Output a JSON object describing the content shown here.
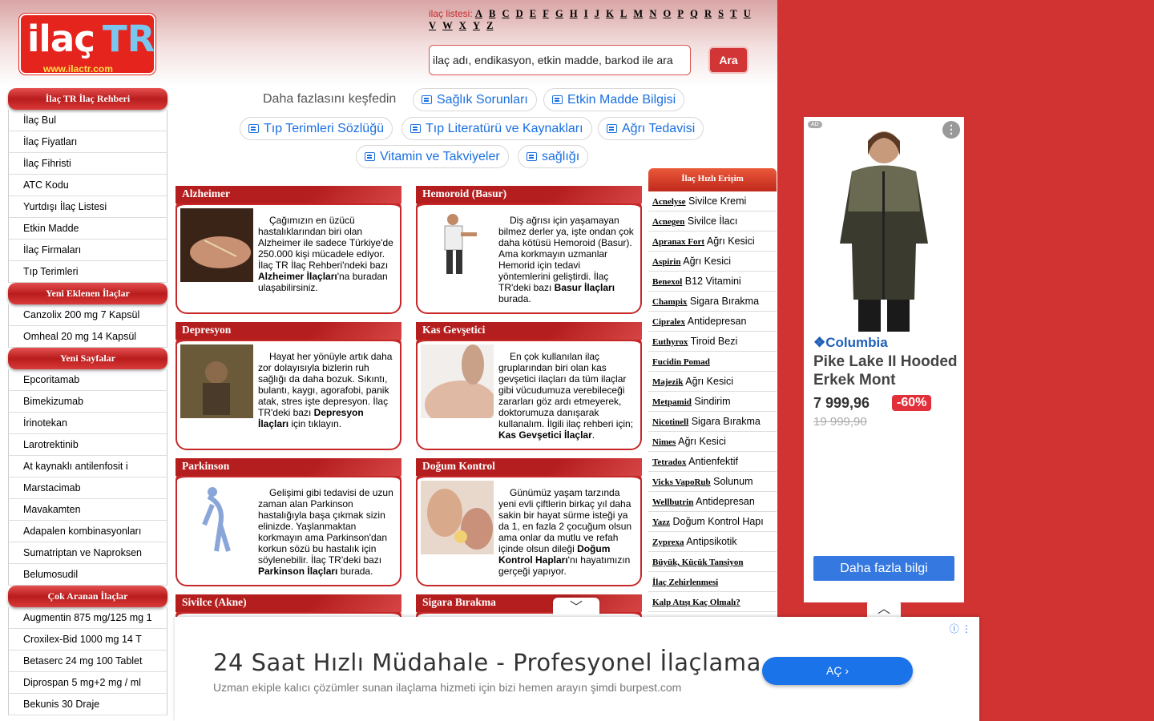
{
  "logo": {
    "part1": "ilaç",
    "part2": "TR",
    "url": "www.ilactr.com"
  },
  "alphabet": {
    "label": "ilaç listesi:",
    "letters": [
      "A",
      "B",
      "C",
      "D",
      "E",
      "F",
      "G",
      "H",
      "I",
      "J",
      "K",
      "L",
      "M",
      "N",
      "O",
      "P",
      "Q",
      "R",
      "S",
      "T",
      "U",
      "V",
      "W",
      "X",
      "Y",
      "Z"
    ]
  },
  "search": {
    "placeholder": "ilaç adı, endikasyon, etkin madde, barkod ile ara",
    "button": "Ara"
  },
  "sidebar": {
    "sections": [
      {
        "title": "İlaç TR İlaç Rehberi",
        "items": [
          "İlaç Bul",
          "İlaç Fiyatları",
          "İlaç Fihristi",
          "ATC Kodu",
          "Yurtdışı İlaç Listesi",
          "Etkin Madde",
          "İlaç Firmaları",
          "Tıp Terimleri"
        ]
      },
      {
        "title": "Yeni Eklenen İlaçlar",
        "items": [
          "Canzolix 200 mg 7 Kapsül",
          "Omheal 20 mg 14 Kapsül"
        ]
      },
      {
        "title": "Yeni Sayfalar",
        "items": [
          "Epcoritamab",
          "Bimekizumab",
          "İrinotekan",
          "Larotrektinib",
          "At kaynaklı antilenfosit i",
          "Marstacimab",
          "Mavakamten",
          "Adapalen kombinasyonları",
          "Sumatriptan ve Naproksen",
          "Belumosudil"
        ]
      },
      {
        "title": "Çok Aranan İlaçlar",
        "items": [
          "Augmentin 875 mg/125 mg 1",
          "Croxilex-Bid 1000 mg 14 T",
          "Betaserc 24 mg 100 Tablet",
          "Diprospan 5 mg+2 mg / ml",
          "Bekunis 30 Draje"
        ]
      }
    ]
  },
  "explore": {
    "label": "Daha fazlasını keşfedin",
    "pills": [
      "Sağlık Sorunları",
      "Etkin Madde Bilgisi",
      "Tıp Terimleri Sözlüğü",
      "Tıp Literatürü ve Kaynakları",
      "Ağrı Tedavisi",
      "Vitamin ve Takviyeler",
      "sağlığı"
    ]
  },
  "cards": [
    {
      "title": "Alzheimer",
      "pre": "Çağımızın en üzücü hastalıklarından biri olan Alzheimer ile sadece Türkiye'de 250.000 kişi mücadele ediyor. İlaç TR İlaç Rehberi'ndeki bazı ",
      "bold": "Alzheimer İlaçları",
      "post": "'na buradan ulaşabilirsiniz."
    },
    {
      "title": "Hemoroid (Basur)",
      "pre": "Diş ağrısı için yaşamayan bilmez derler ya, işte ondan çok daha kötüsü Hemoroid (Basur). Ama korkmayın uzmanlar Hemorid için tedavi yöntemlerini geliştirdi. İlaç TR'deki bazı ",
      "bold": "Basur İlaçları",
      "post": " burada."
    },
    {
      "title": "Depresyon",
      "pre": "Hayat her yönüyle artık daha zor dolayısıyla bizlerin ruh sağlığı da daha bozuk. Sıkıntı, bulantı, kaygı, agorafobi, panik atak, stres işte depresyon. İlaç TR'deki bazı ",
      "bold": "Depresyon İlaçları",
      "post": " için tıklayın."
    },
    {
      "title": "Kas Gevşetici",
      "pre": "En çok kullanılan ilaç gruplarından biri olan kas gevşetici ilaçları da tüm ilaçlar gibi vücudumuza verebileceği zararları göz ardı etmeyerek, doktorumuza danışarak kullanalım. İlgili ilaç rehberi için; ",
      "bold": "Kas Gevşetici İlaçlar",
      "post": "."
    },
    {
      "title": "Parkinson",
      "pre": "Gelişimi gibi tedavisi de uzun zaman alan Parkinson hastalığıyla başa çıkmak sizin elinizde. Yaşlanmaktan korkmayın ama Parkinson'dan korkun sözü bu hastalık için söylenebilir. İlaç TR'deki bazı ",
      "bold": "Parkinson İlaçları",
      "post": " burada."
    },
    {
      "title": "Doğum Kontrol",
      "pre": "Günümüz yaşam tarzında yeni evli çiftlerin birkaç yıl daha sakin bir hayat sürme isteği ya da 1, en fazla 2 çocuğum olsun ama onlar da mutlu ve refah içinde olsun dileği ",
      "bold": "Doğum Kontrol Hapları",
      "post": "'nı hayatımızın gerçeği yapıyor."
    },
    {
      "title": "Sivilce (Akne)",
      "pre": "",
      "bold": "",
      "post": ""
    },
    {
      "title": "Sigara Bırakma",
      "pre": "",
      "bold": "",
      "post": ""
    }
  ],
  "quick": {
    "title": "İlaç Hızlı Erişim",
    "items": [
      {
        "name": "Acnelyse",
        "desc": "Sivilce Kremi"
      },
      {
        "name": "Acnegen",
        "desc": "Sivilce İlacı"
      },
      {
        "name": "Apranax Fort",
        "desc": "Ağrı Kesici"
      },
      {
        "name": "Aspirin",
        "desc": "Ağrı Kesici"
      },
      {
        "name": "Benexol",
        "desc": "B12 Vitamini"
      },
      {
        "name": "Champix",
        "desc": "Sigara Bırakma"
      },
      {
        "name": "Cipralex",
        "desc": "Antidepresan"
      },
      {
        "name": "Euthyrox",
        "desc": "Tiroid Bezi"
      },
      {
        "name": "Fucidin Pomad",
        "desc": ""
      },
      {
        "name": "Majezik",
        "desc": "Ağrı Kesici"
      },
      {
        "name": "Metpamid",
        "desc": "Sindirim"
      },
      {
        "name": "Nicotinell",
        "desc": "Sigara Bırakma"
      },
      {
        "name": "Nimes",
        "desc": "Ağrı Kesici"
      },
      {
        "name": "Tetradox",
        "desc": "Antienfektif"
      },
      {
        "name": "Vicks VapoRub",
        "desc": "Solunum"
      },
      {
        "name": "Wellbutrin",
        "desc": "Antidepresan"
      },
      {
        "name": "Yazz",
        "desc": "Doğum Kontrol Hapı"
      },
      {
        "name": "Zyprexa",
        "desc": "Antipsikotik"
      },
      {
        "name": "Büyük, Küçük Tansiyon",
        "desc": ""
      },
      {
        "name": "İlaç Zehirlenmesi",
        "desc": ""
      },
      {
        "name": "Kalp Atışı Kaç Olmalı?",
        "desc": ""
      }
    ]
  },
  "ad_side": {
    "tag": "AD",
    "brand": "Columbia",
    "product": "Pike Lake II Hooded Erkek Mont",
    "price": "7 999,96",
    "discount": "-60%",
    "old_price": "19 999,90",
    "button": "Daha fazla bilgi"
  },
  "ad_bottom": {
    "headline": "24 Saat Hızlı Müdahale - Profesyonel İlaçlama",
    "text": "Uzman ekiple kalıcı çözümler sunan ilaçlama hizmeti için bizi hemen arayın şimdi burpest.com",
    "button": "AÇ"
  }
}
